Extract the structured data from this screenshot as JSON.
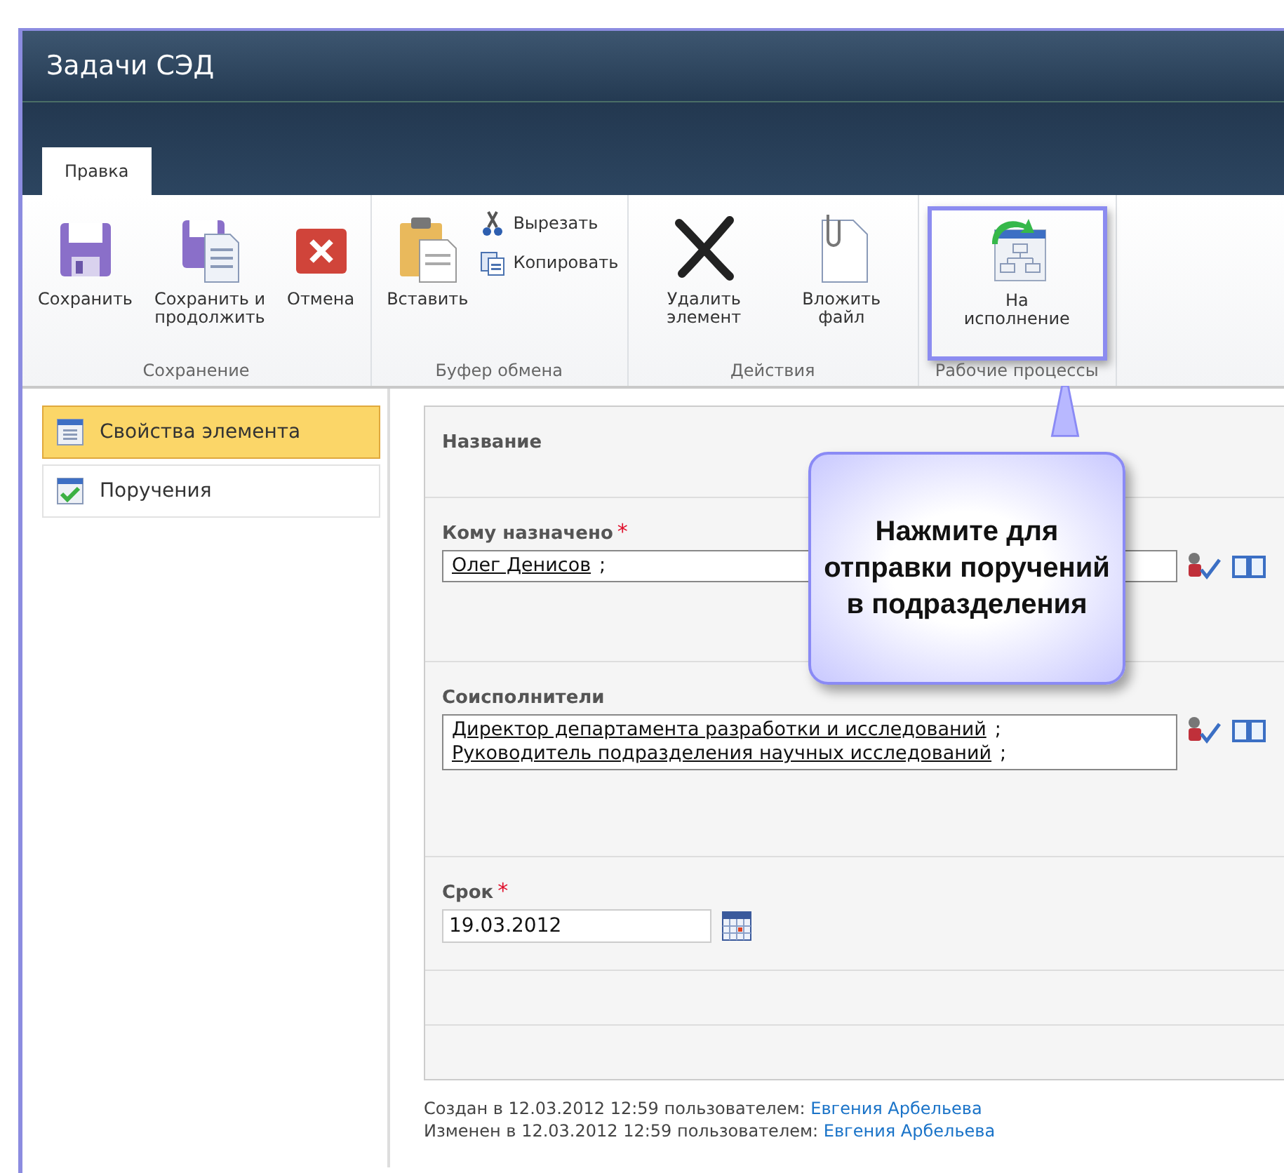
{
  "window": {
    "title": "Задачи СЭД"
  },
  "tabs": [
    {
      "label": "Правка",
      "selected": true
    }
  ],
  "ribbon": {
    "groups": [
      {
        "label": "Сохранение",
        "buttons": [
          {
            "kind": "large",
            "label": "Сохранить",
            "highlighted": false
          },
          {
            "kind": "large",
            "label": "Сохранить и продолжить",
            "highlighted": false
          },
          {
            "kind": "large",
            "label": "Отмена",
            "highlighted": false
          }
        ]
      },
      {
        "label": "Буфер обмена",
        "buttons": [
          {
            "kind": "large",
            "label": "Вставить",
            "highlighted": false
          },
          {
            "kind": "small",
            "label": "Вырезать"
          },
          {
            "kind": "small",
            "label": "Копировать"
          }
        ]
      },
      {
        "label": "Действия",
        "buttons": [
          {
            "kind": "large",
            "label": "Удалить элемент",
            "highlighted": false
          },
          {
            "kind": "large",
            "label": "Вложить файл",
            "highlighted": false
          }
        ]
      },
      {
        "label": "Рабочие процессы",
        "buttons": [
          {
            "kind": "large",
            "label": "На исполнение",
            "highlighted": true
          }
        ]
      }
    ]
  },
  "sidebar": {
    "items": [
      {
        "label": "Свойства элемента",
        "selected": true
      },
      {
        "label": "Поручения",
        "selected": false
      }
    ]
  },
  "form": {
    "rows": [
      {
        "kind": "empty",
        "label": "Название"
      },
      {
        "kind": "people",
        "label": "Кому назначено",
        "required_mark": "*",
        "entries": [
          {
            "name": "Олег Денисов",
            "suffix": ";"
          }
        ]
      },
      {
        "kind": "people",
        "label": "Соисполнители",
        "entries": [
          {
            "name": "Директор департамента разработки и исследований",
            "suffix": ";"
          },
          {
            "name": "Руководитель подразделения научных исследований",
            "suffix": ";"
          }
        ]
      },
      {
        "kind": "date",
        "label": "Срок",
        "required_mark": "*",
        "value": "19.03.2012"
      },
      {
        "kind": "blank"
      },
      {
        "kind": "blank"
      }
    ]
  },
  "footer": [
    {
      "text": "Создан в 12.03.2012 12:59 пользователем:",
      "user": "Евгения Арбельева"
    },
    {
      "text": "Изменен в 12.03.2012 12:59 пользователем:",
      "user": "Евгения Арбельева"
    }
  ],
  "callout": {
    "text": "Нажмите для отправки поручений в подразделения"
  }
}
